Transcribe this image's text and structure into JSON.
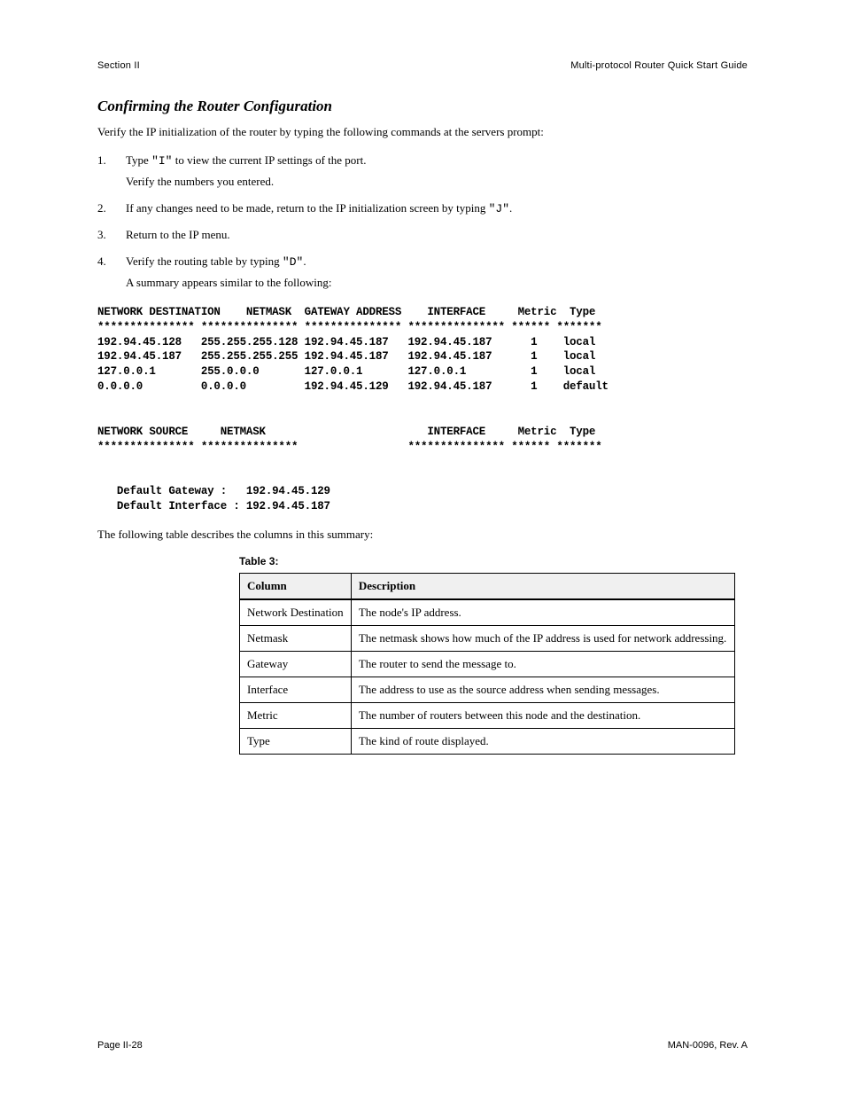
{
  "header": {
    "left": "Section II",
    "right": "Multi-protocol Router Quick Start Guide"
  },
  "section": {
    "title": "Confirming the Router Configuration",
    "intro": "Verify the IP initialization of the router by typing the following commands at the servers prompt:"
  },
  "steps": [
    {
      "num": "1.",
      "lines": [
        "Type \"I\" to view the current IP settings of the port.",
        "Verify the numbers you entered."
      ]
    },
    {
      "num": "2.",
      "lines": [
        "If any changes need to be made, return to the IP initialization screen by typing \"J\"."
      ]
    },
    {
      "num": "3.",
      "lines": [
        "Return to the IP menu."
      ]
    },
    {
      "num": "4.",
      "lines": [
        "Verify the routing table by typing \"D\".",
        "A summary appears similar to the following:"
      ]
    }
  ],
  "terminal1": {
    "hdr": "NETWORK DESTINATION    NETMASK  GATEWAY ADDRESS    INTERFACE     Metric  Type",
    "stars": "*************** *************** *************** *************** ****** *******",
    "rows": [
      "192.94.45.128   255.255.255.128 192.94.45.187   192.94.45.187      1    local",
      "192.94.45.187   255.255.255.255 192.94.45.187   192.94.45.187      1    local",
      "127.0.0.1       255.0.0.0       127.0.0.1       127.0.0.1          1    local",
      "0.0.0.0         0.0.0.0         192.94.45.129   192.94.45.187      1    default"
    ]
  },
  "terminal2": {
    "hdr": "NETWORK SOURCE     NETMASK                         INTERFACE     Metric  Type",
    "stars": "*************** ***************                 *************** ****** *******"
  },
  "defaults": {
    "gw_label": "   Default Gateway :   192.94.45.129",
    "if_label": "   Default Interface : 192.94.45.187"
  },
  "post": "The following table describes the columns in this summary:",
  "table": {
    "caption": "Table 3:",
    "headers": [
      "Column",
      "Description"
    ],
    "rows": [
      [
        "Network Destination",
        "The node's IP address."
      ],
      [
        "Netmask",
        "The netmask shows how much of the IP address is used for network addressing."
      ],
      [
        "Gateway",
        "The router to send the message to."
      ],
      [
        "Interface",
        "The address to use as the source address when sending messages."
      ],
      [
        "Metric",
        "The number of routers between this node and the destination."
      ],
      [
        "Type",
        "The kind of route displayed."
      ]
    ]
  },
  "footer": {
    "left": "Page II-28",
    "right": "MAN-0096, Rev. A"
  }
}
